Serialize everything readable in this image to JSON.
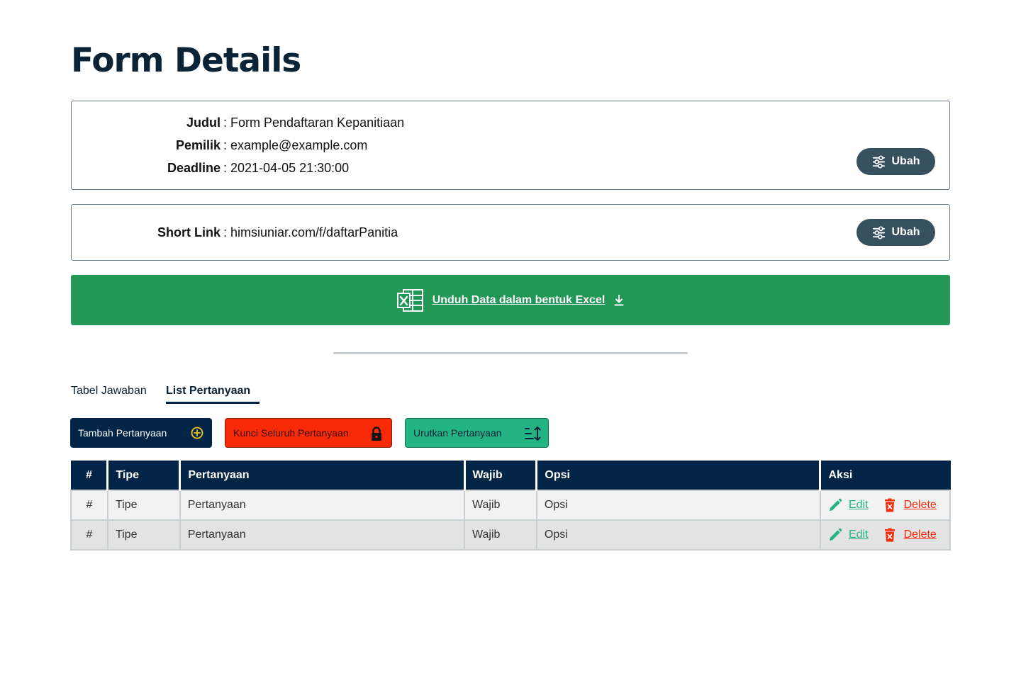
{
  "page": {
    "title": "Form Details"
  },
  "form_info": {
    "judul_label": "Judul",
    "judul_value": "Form Pendaftaran Kepanitiaan",
    "pemilik_label": "Pemilik",
    "pemilik_value": "example@example.com",
    "deadline_label": "Deadline",
    "deadline_value": "2021-04-05 21:30:00",
    "separator": ":",
    "edit_label": "Ubah"
  },
  "short_link": {
    "label": "Short Link",
    "value": "himsiuniar.com/f/daftarPanitia",
    "edit_label": "Ubah"
  },
  "download": {
    "label": "Unduh Data dalam bentuk Excel",
    "icon": "excel-icon"
  },
  "tabs": [
    {
      "label": "Tabel Jawaban",
      "active": false
    },
    {
      "label": "List Pertanyaan",
      "active": true
    }
  ],
  "actions": {
    "add": {
      "label": "Tambah Pertanyaan",
      "icon": "plus-circle-icon"
    },
    "lock": {
      "label": "Kunci Seluruh Pertanyaan",
      "icon": "lock-icon"
    },
    "sort": {
      "label": "Urutkan Pertanyaan",
      "icon": "sort-icon"
    }
  },
  "table": {
    "headers": [
      "#",
      "Tipe",
      "Pertanyaan",
      "Wajib",
      "Opsi",
      "Aksi"
    ],
    "rows": [
      {
        "num": "#",
        "tipe": "Tipe",
        "pertanyaan": "Pertanyaan",
        "wajib": "Wajib",
        "opsi": "Opsi",
        "edit": "Edit",
        "delete": "Delete"
      },
      {
        "num": "#",
        "tipe": "Tipe",
        "pertanyaan": "Pertanyaan",
        "wajib": "Wajib",
        "opsi": "Opsi",
        "edit": "Edit",
        "delete": "Delete"
      }
    ]
  },
  "colors": {
    "navy": "#012447",
    "green": "#239755",
    "teal": "#24b383",
    "red": "#f82a08",
    "slate": "#37505f"
  }
}
